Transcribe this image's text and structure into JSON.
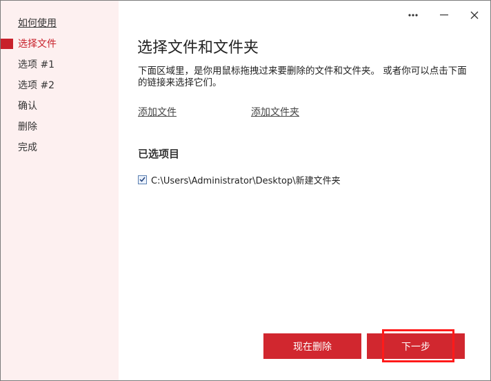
{
  "window": {
    "controls": {
      "more": "more-icon",
      "minimize": "minimize-icon",
      "close": "close-icon"
    }
  },
  "sidebar": {
    "items": [
      {
        "label": "如何使用",
        "link": true,
        "active": false
      },
      {
        "label": "选择文件",
        "link": false,
        "active": true
      },
      {
        "label": "选项 #1",
        "link": false,
        "active": false
      },
      {
        "label": "选项 #2",
        "link": false,
        "active": false
      },
      {
        "label": "确认",
        "link": false,
        "active": false
      },
      {
        "label": "删除",
        "link": false,
        "active": false
      },
      {
        "label": "完成",
        "link": false,
        "active": false
      }
    ]
  },
  "main": {
    "title": "选择文件和文件夹",
    "description": "下面区域里，是你用鼠标拖拽过来要删除的文件和文件夹。 或者你可以点击下面的链接来选择它们。",
    "add_file": "添加文件",
    "add_folder": "添加文件夹",
    "selected_title": "已选项目",
    "selected_items": [
      {
        "path": "C:\\Users\\Administrator\\Desktop\\新建文件夹",
        "checked": true
      }
    ]
  },
  "footer": {
    "delete_now": "现在删除",
    "next": "下一步"
  },
  "colors": {
    "accent": "#c8202a",
    "button": "#d1272f",
    "sidebar_bg": "#fdf0f0",
    "highlight": "#ff1a1a"
  }
}
